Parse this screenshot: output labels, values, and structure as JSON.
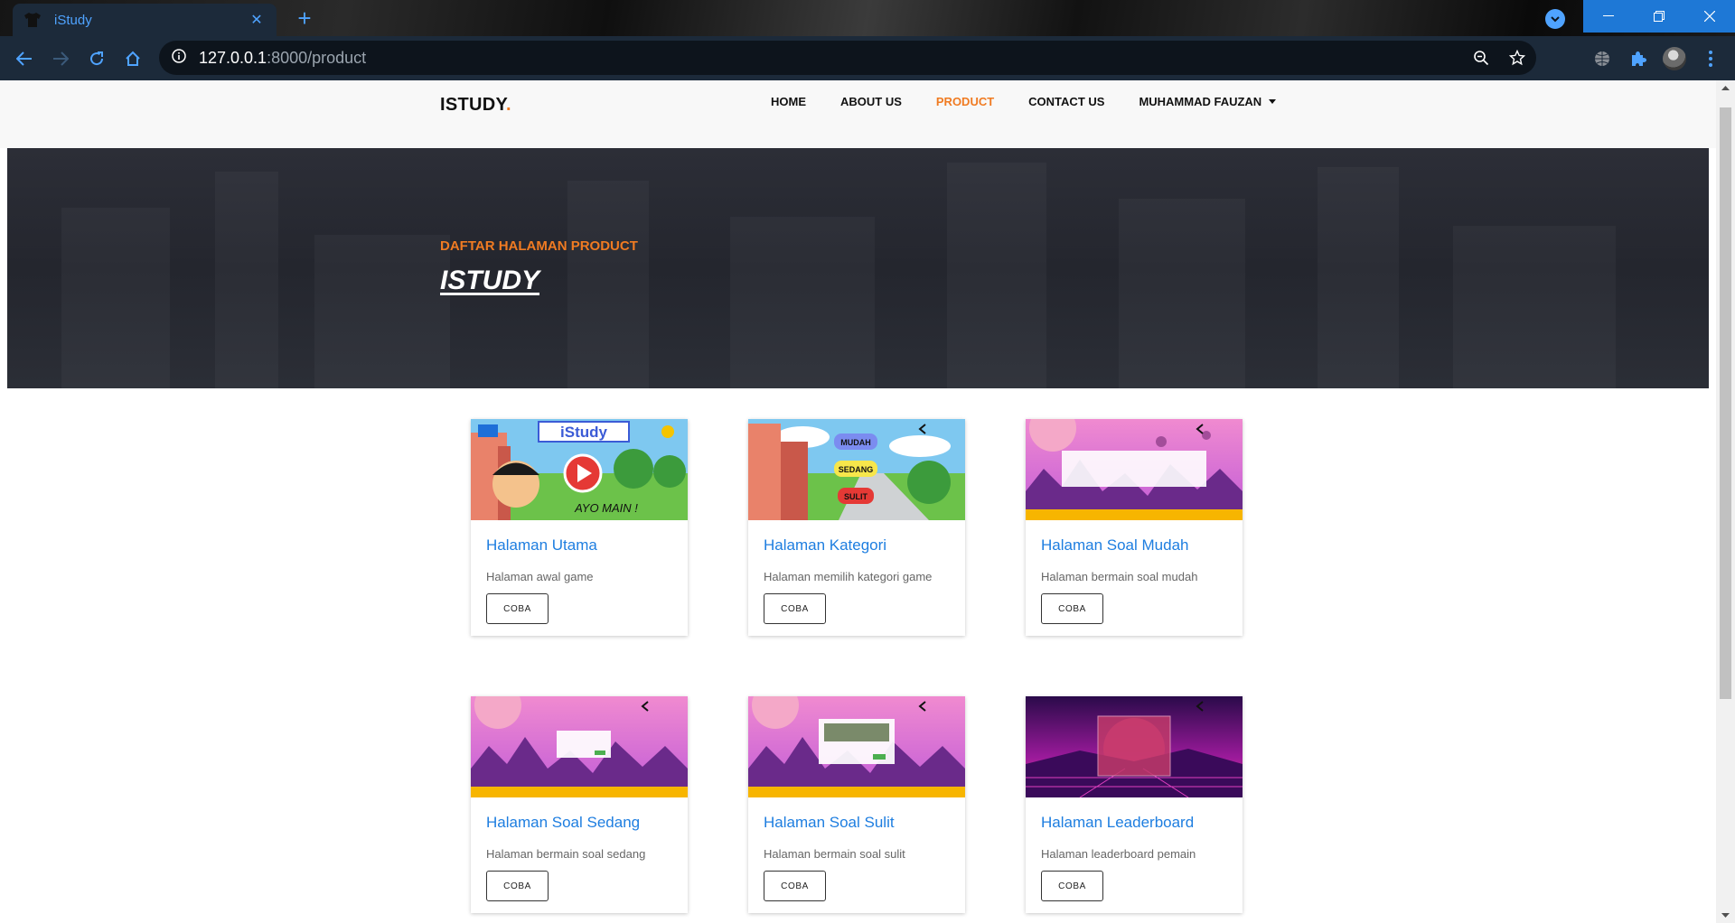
{
  "browser": {
    "tab_title": "iStudy",
    "url_host": "127.0.0.1",
    "url_path": ":8000/product"
  },
  "site": {
    "logo": "ISTUDY",
    "logo_dot": ".",
    "menu": [
      {
        "label": "HOME",
        "active": false
      },
      {
        "label": "ABOUT US",
        "active": false
      },
      {
        "label": "PRODUCT",
        "active": true
      },
      {
        "label": "CONTACT US",
        "active": false
      },
      {
        "label": "MUHAMMAD FAUZAN",
        "active": false
      }
    ],
    "hero_subtitle": "DAFTAR HALAMAN PRODUCT",
    "hero_title": "ISTUDY"
  },
  "thumb_text": {
    "main_title": "iStudy",
    "main_tagline": "AYO MAIN !",
    "cat_easy": "MUDAH",
    "cat_medium": "SEDANG",
    "cat_hard": "SULIT"
  },
  "cards": [
    {
      "title": "Halaman Utama",
      "desc": "Halaman awal game",
      "button": "COBA"
    },
    {
      "title": "Halaman Kategori",
      "desc": "Halaman memilih kategori game",
      "button": "COBA"
    },
    {
      "title": "Halaman Soal Mudah",
      "desc": "Halaman bermain soal mudah",
      "button": "COBA"
    },
    {
      "title": "Halaman Soal Sedang",
      "desc": "Halaman bermain soal sedang",
      "button": "COBA"
    },
    {
      "title": "Halaman Soal Sulit",
      "desc": "Halaman bermain soal sulit",
      "button": "COBA"
    },
    {
      "title": "Halaman Leaderboard",
      "desc": "Halaman leaderboard pemain",
      "button": "COBA"
    }
  ],
  "colors": {
    "accent": "#f07b22",
    "link": "#1e7ee0",
    "chrome": "#1c2a3a",
    "window_buttons": "#1e78d6"
  },
  "icons": {
    "back": "arrow-left-icon",
    "forward": "arrow-right-icon",
    "reload": "reload-icon",
    "home": "home-icon",
    "info": "info-icon",
    "zoom": "zoom-icon",
    "bookmark": "star-icon",
    "extensions": "puzzle-icon"
  }
}
